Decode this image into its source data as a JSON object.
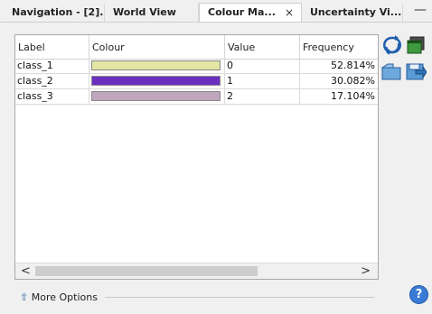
{
  "tabs": [
    {
      "label": "Navigation - [2]...",
      "active": false
    },
    {
      "label": "World View",
      "active": false
    },
    {
      "label": "Colour Ma...",
      "active": true,
      "close": "×"
    },
    {
      "label": "Uncertainty Vi...",
      "active": false
    }
  ],
  "minimize_label": "—",
  "table": {
    "headers": [
      "Label",
      "Colour",
      "Value",
      "Frequency"
    ],
    "rows": [
      {
        "label": "class_1",
        "colour": "#e3e6a4",
        "value": "0",
        "frequency": "52.814%"
      },
      {
        "label": "class_2",
        "colour": "#6a2fbf",
        "value": "1",
        "frequency": "30.082%"
      },
      {
        "label": "class_3",
        "colour": "#bfa6bd",
        "value": "2",
        "frequency": "17.104%"
      }
    ]
  },
  "scroll": {
    "left_arrow": "<",
    "right_arrow": ">"
  },
  "side_icons": [
    "refresh-icon",
    "copy-window-icon",
    "open-folder-icon",
    "save-icon"
  ],
  "more_options": {
    "icon": "double-chevron-up-icon",
    "label": "More Options"
  },
  "help_label": "?",
  "colors": {
    "accent": "#3a7bd5"
  }
}
